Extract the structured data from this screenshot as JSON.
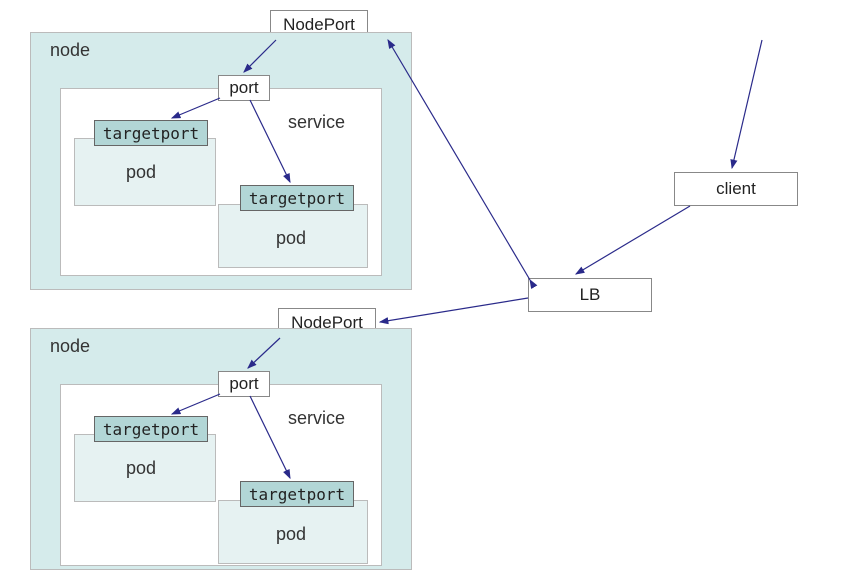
{
  "nodes": [
    {
      "label": "node",
      "service": {
        "label": "service",
        "port_label": "port",
        "pods": [
          {
            "label": "pod",
            "targetport_label": "targetport"
          },
          {
            "label": "pod",
            "targetport_label": "targetport"
          }
        ]
      },
      "nodeport_label": "NodePort"
    },
    {
      "label": "node",
      "service": {
        "label": "service",
        "port_label": "port",
        "pods": [
          {
            "label": "pod",
            "targetport_label": "targetport"
          },
          {
            "label": "pod",
            "targetport_label": "targetport"
          }
        ]
      },
      "nodeport_label": "NodePort"
    }
  ],
  "lb_label": "LB",
  "client_label": "client"
}
